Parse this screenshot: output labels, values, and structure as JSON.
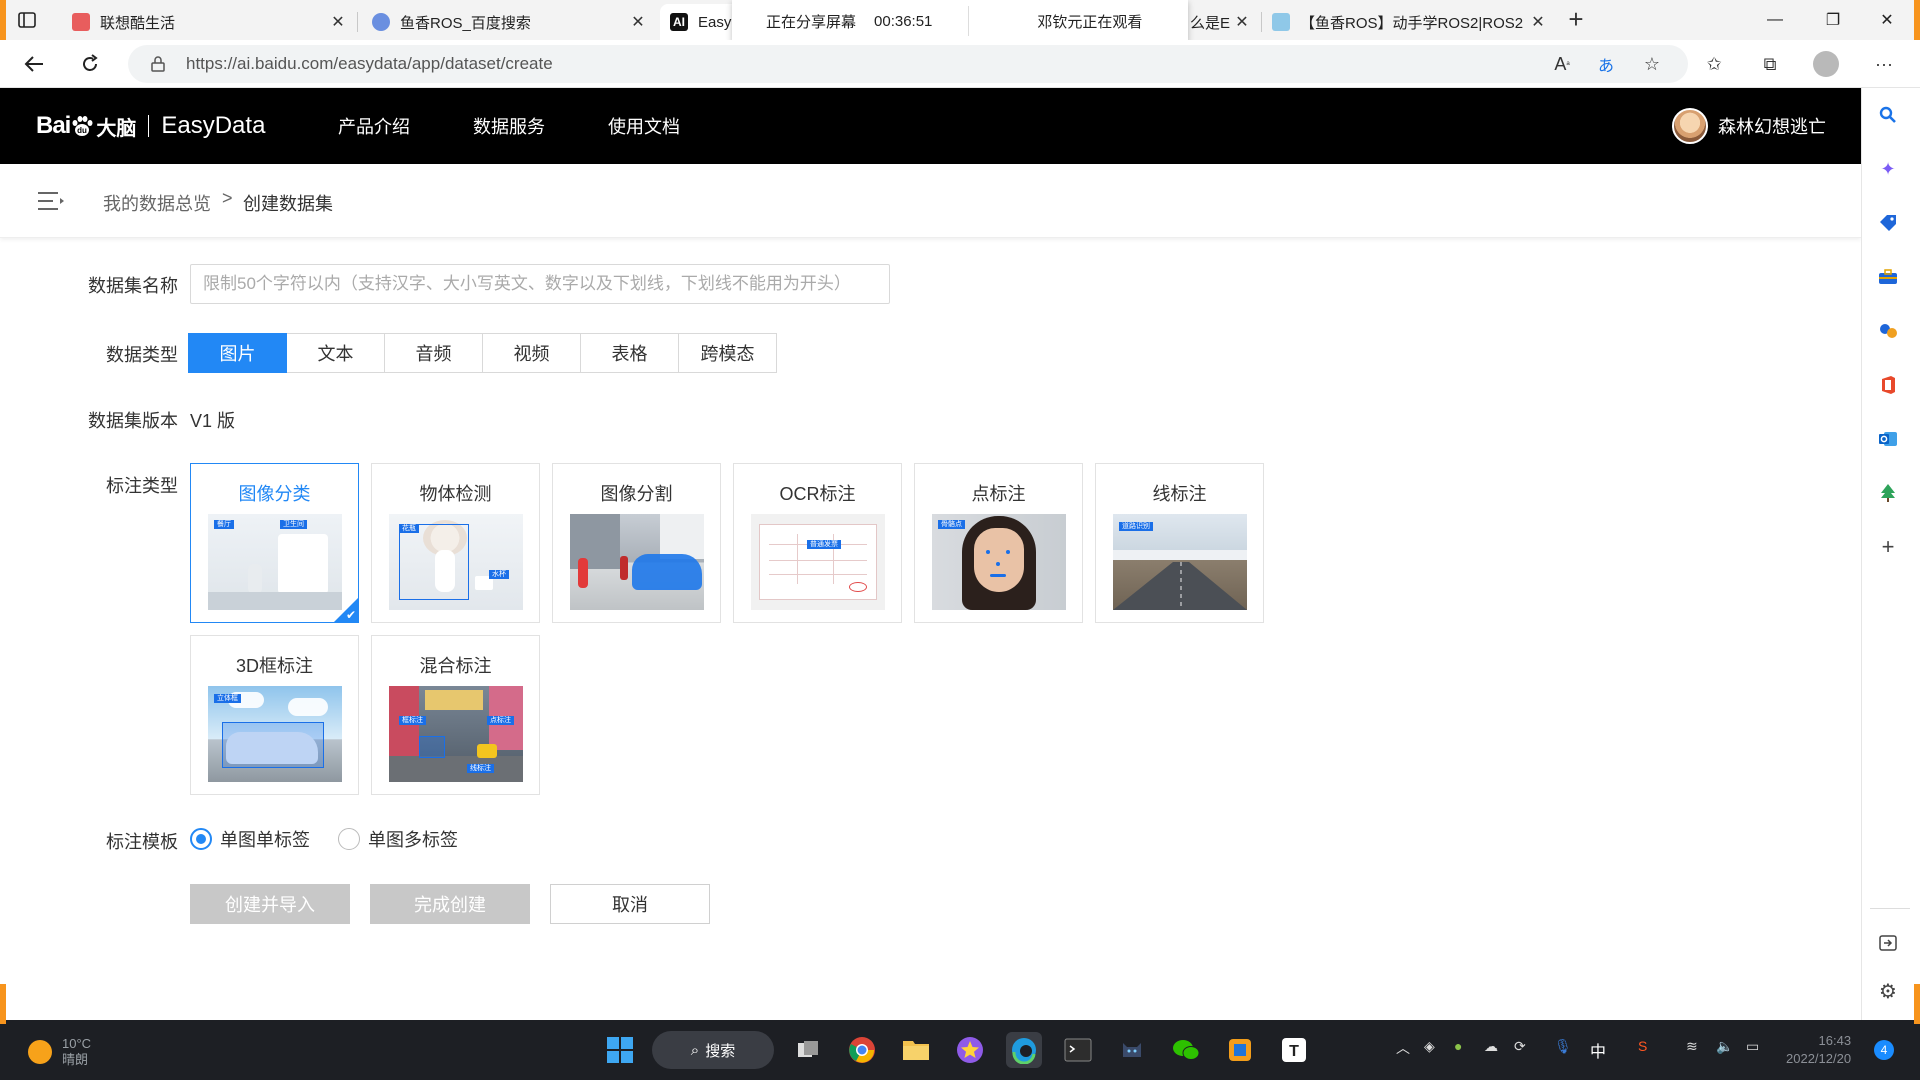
{
  "browser": {
    "tabs": [
      {
        "title": "联想酷生活",
        "favicon_color": "#e85d5d"
      },
      {
        "title": "鱼香ROS_百度搜索",
        "favicon_color": "#6a8fe0"
      },
      {
        "title": "Easy",
        "favicon_color": "#111111"
      },
      {
        "title": "么是E",
        "favicon_color": "#ffffff"
      },
      {
        "title": "【鱼香ROS】动手学ROS2|ROS2",
        "favicon_color": "#8fc8e8"
      }
    ],
    "share_banner": {
      "status": "正在分享屏幕",
      "timer": "00:36:51",
      "viewer": "邓钦元正在观看"
    },
    "url": "https://ai.baidu.com/easydata/app/dataset/create"
  },
  "header": {
    "logo_bai": "Bai",
    "logo_du": "du",
    "logo_brain": "大脑",
    "logo_product": "EasyData",
    "nav": [
      "产品介绍",
      "数据服务",
      "使用文档"
    ],
    "username": "森林幻想逃亡"
  },
  "breadcrumb": {
    "parent": "我的数据总览",
    "separator": ">",
    "current": "创建数据集"
  },
  "form": {
    "name_label": "数据集名称",
    "name_placeholder": "限制50个字符以内（支持汉字、大小写英文、数字以及下划线，下划线不能用为开头）",
    "type_label": "数据类型",
    "types": [
      "图片",
      "文本",
      "音频",
      "视频",
      "表格",
      "跨模态"
    ],
    "selected_type_index": 0,
    "version_label": "数据集版本",
    "version_value": "V1 版",
    "annot_label": "标注类型",
    "annot_types": [
      "图像分类",
      "物体检测",
      "图像分割",
      "OCR标注",
      "点标注",
      "线标注",
      "3D框标注",
      "混合标注"
    ],
    "selected_annot_index": 0,
    "thumb_tags": {
      "cls_a": "餐厅",
      "cls_b": "卫生间",
      "det_a": "花瓶",
      "det_b": "水杯",
      "ocr_a": "普通发票",
      "pt_a": "骨骼点",
      "line_a": "道路识别",
      "box3d_a": "立体框",
      "mix_a": "框标注",
      "mix_b": "点标注",
      "mix_c": "线标注"
    },
    "template_label": "标注模板",
    "templates": [
      "单图单标签",
      "单图多标签"
    ],
    "selected_template_index": 0,
    "buttons": {
      "create_import": "创建并导入",
      "finish": "完成创建",
      "cancel": "取消"
    }
  },
  "taskbar": {
    "weather_temp": "10°C",
    "weather_desc": "晴朗",
    "search_label": "搜索",
    "ime": "中",
    "time": "16:43",
    "date": "2022/12/20",
    "notifications": "4"
  },
  "colors": {
    "accent": "#2288f5",
    "header_bg": "#000000",
    "disabled": "#c8c8c8"
  }
}
